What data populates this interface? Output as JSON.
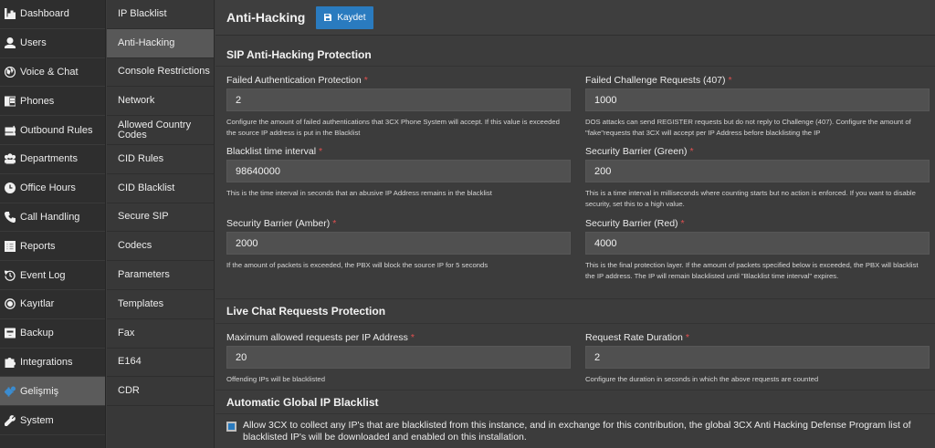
{
  "nav": {
    "items": [
      {
        "label": "Dashboard",
        "icon": "dashboard-icon"
      },
      {
        "label": "Users",
        "icon": "user-icon"
      },
      {
        "label": "Voice & Chat",
        "icon": "globe-icon"
      },
      {
        "label": "Phones",
        "icon": "phone-grid-icon"
      },
      {
        "label": "Outbound Rules",
        "icon": "outbound-arrow-icon"
      },
      {
        "label": "Departments",
        "icon": "group-icon"
      },
      {
        "label": "Office Hours",
        "icon": "clock-icon"
      },
      {
        "label": "Call Handling",
        "icon": "handset-icon"
      },
      {
        "label": "Reports",
        "icon": "list-icon"
      },
      {
        "label": "Event Log",
        "icon": "history-icon"
      },
      {
        "label": "Kayıtlar",
        "icon": "record-icon"
      },
      {
        "label": "Backup",
        "icon": "backup-icon"
      },
      {
        "label": "Integrations",
        "icon": "puzzle-icon"
      },
      {
        "label": "Gelişmiş",
        "icon": "gears-icon"
      },
      {
        "label": "System",
        "icon": "wrench-icon"
      }
    ]
  },
  "submenu": {
    "items": [
      "IP Blacklist",
      "Anti-Hacking",
      "Console Restrictions",
      "Network",
      "Allowed Country Codes",
      "CID Rules",
      "CID Blacklist",
      "Secure SIP",
      "Codecs",
      "Parameters",
      "Templates",
      "Fax",
      "E164",
      "CDR"
    ]
  },
  "header": {
    "title": "Anti-Hacking",
    "save_label": "Kaydet"
  },
  "sip": {
    "title": "SIP Anti-Hacking Protection",
    "failed_auth": {
      "label": "Failed Authentication Protection",
      "value": "2",
      "help": "Configure the amount of failed authentications that 3CX Phone System will accept. If this value is exceeded the source IP address is put in the Blacklist"
    },
    "failed_challenge": {
      "label": "Failed Challenge Requests (407)",
      "value": "1000",
      "help": "DOS attacks can send REGISTER requests but do not reply to Challenge (407). Configure the amount of \"fake\"requests that 3CX will accept per IP Address before blacklisting the IP"
    },
    "blacklist_interval": {
      "label": "Blacklist time interval",
      "value": "98640000",
      "help": "This is the time interval in seconds that an abusive IP Address remains in the blacklist"
    },
    "barrier_green": {
      "label": "Security Barrier (Green)",
      "value": "200",
      "help": "This is a time interval in milliseconds where counting starts but no action is enforced. If you want to disable security, set this to a high value."
    },
    "barrier_amber": {
      "label": "Security Barrier (Amber)",
      "value": "2000",
      "help": "If the amount of packets is exceeded, the PBX will block the source IP for 5 seconds"
    },
    "barrier_red": {
      "label": "Security Barrier (Red)",
      "value": "4000",
      "help": "This is the final protection layer. If the amount of packets specified below is exceeded, the PBX will blacklist the IP address. The IP will remain blacklisted until \"Blacklist time interval\" expires."
    }
  },
  "chat": {
    "title": "Live Chat Requests Protection",
    "max_requests": {
      "label": "Maximum allowed requests per IP Address",
      "value": "20",
      "help": "Offending IPs will be blacklisted"
    },
    "rate_duration": {
      "label": "Request Rate Duration",
      "value": "2",
      "help": "Configure the duration in seconds in which the above requests are counted"
    }
  },
  "global": {
    "title": "Automatic Global IP Blacklist",
    "checkbox_label": "Allow 3CX to collect any IP's that are blacklisted from this instance, and in exchange for this contribution, the global 3CX Anti Hacking Defense Program list of blacklisted IP's will be downloaded and enabled on this installation.",
    "checked": true
  },
  "colors": {
    "accent": "#2a7bbf",
    "required": "#e05050"
  }
}
